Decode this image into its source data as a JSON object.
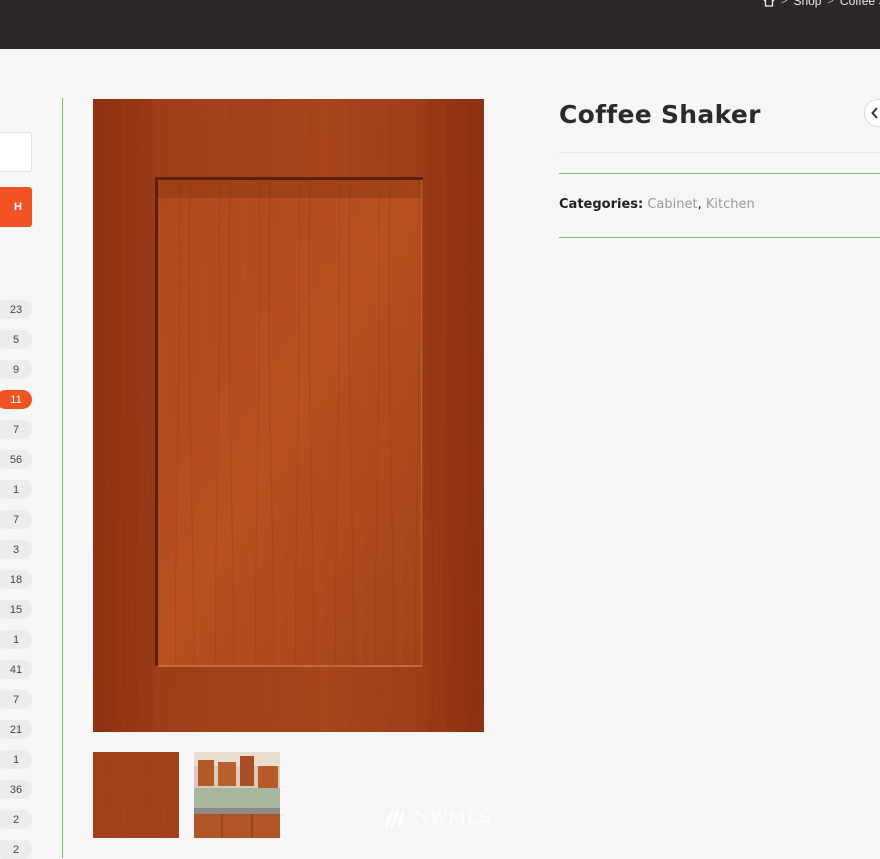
{
  "breadcrumb": {
    "home_icon": "home-icon",
    "separator": ">",
    "items": [
      "Shop",
      "Coffee Shaker"
    ]
  },
  "sidebar": {
    "search_button_label": "H",
    "counts": [
      "23",
      "5",
      "9",
      "11",
      "7",
      "56",
      "1",
      "7",
      "3",
      "18",
      "15",
      "1",
      "41",
      "7",
      "21",
      "1",
      "36",
      "2",
      "2"
    ],
    "active_index": 3
  },
  "product": {
    "title": "Coffee Shaker",
    "categories_label": "Categories:",
    "categories": [
      "Cabinet",
      "Kitchen"
    ],
    "category_separator": ", "
  },
  "watermark": {
    "text": "NWMLS"
  },
  "colors": {
    "topbar": "#2e2729",
    "accent": "#f05323",
    "green_rule": "#7cba5a",
    "wood": "#a8401a"
  }
}
